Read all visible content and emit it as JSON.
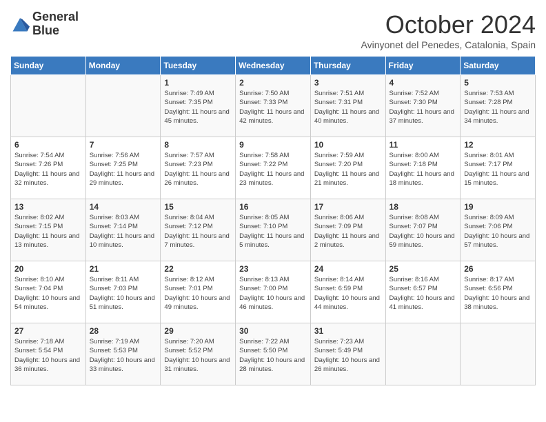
{
  "logo": {
    "line1": "General",
    "line2": "Blue"
  },
  "title": "October 2024",
  "subtitle": "Avinyonet del Penedes, Catalonia, Spain",
  "headers": [
    "Sunday",
    "Monday",
    "Tuesday",
    "Wednesday",
    "Thursday",
    "Friday",
    "Saturday"
  ],
  "weeks": [
    [
      {
        "day": "",
        "lines": []
      },
      {
        "day": "",
        "lines": []
      },
      {
        "day": "1",
        "lines": [
          "Sunrise: 7:49 AM",
          "Sunset: 7:35 PM",
          "Daylight: 11 hours and 45 minutes."
        ]
      },
      {
        "day": "2",
        "lines": [
          "Sunrise: 7:50 AM",
          "Sunset: 7:33 PM",
          "Daylight: 11 hours and 42 minutes."
        ]
      },
      {
        "day": "3",
        "lines": [
          "Sunrise: 7:51 AM",
          "Sunset: 7:31 PM",
          "Daylight: 11 hours and 40 minutes."
        ]
      },
      {
        "day": "4",
        "lines": [
          "Sunrise: 7:52 AM",
          "Sunset: 7:30 PM",
          "Daylight: 11 hours and 37 minutes."
        ]
      },
      {
        "day": "5",
        "lines": [
          "Sunrise: 7:53 AM",
          "Sunset: 7:28 PM",
          "Daylight: 11 hours and 34 minutes."
        ]
      }
    ],
    [
      {
        "day": "6",
        "lines": [
          "Sunrise: 7:54 AM",
          "Sunset: 7:26 PM",
          "Daylight: 11 hours and 32 minutes."
        ]
      },
      {
        "day": "7",
        "lines": [
          "Sunrise: 7:56 AM",
          "Sunset: 7:25 PM",
          "Daylight: 11 hours and 29 minutes."
        ]
      },
      {
        "day": "8",
        "lines": [
          "Sunrise: 7:57 AM",
          "Sunset: 7:23 PM",
          "Daylight: 11 hours and 26 minutes."
        ]
      },
      {
        "day": "9",
        "lines": [
          "Sunrise: 7:58 AM",
          "Sunset: 7:22 PM",
          "Daylight: 11 hours and 23 minutes."
        ]
      },
      {
        "day": "10",
        "lines": [
          "Sunrise: 7:59 AM",
          "Sunset: 7:20 PM",
          "Daylight: 11 hours and 21 minutes."
        ]
      },
      {
        "day": "11",
        "lines": [
          "Sunrise: 8:00 AM",
          "Sunset: 7:18 PM",
          "Daylight: 11 hours and 18 minutes."
        ]
      },
      {
        "day": "12",
        "lines": [
          "Sunrise: 8:01 AM",
          "Sunset: 7:17 PM",
          "Daylight: 11 hours and 15 minutes."
        ]
      }
    ],
    [
      {
        "day": "13",
        "lines": [
          "Sunrise: 8:02 AM",
          "Sunset: 7:15 PM",
          "Daylight: 11 hours and 13 minutes."
        ]
      },
      {
        "day": "14",
        "lines": [
          "Sunrise: 8:03 AM",
          "Sunset: 7:14 PM",
          "Daylight: 11 hours and 10 minutes."
        ]
      },
      {
        "day": "15",
        "lines": [
          "Sunrise: 8:04 AM",
          "Sunset: 7:12 PM",
          "Daylight: 11 hours and 7 minutes."
        ]
      },
      {
        "day": "16",
        "lines": [
          "Sunrise: 8:05 AM",
          "Sunset: 7:10 PM",
          "Daylight: 11 hours and 5 minutes."
        ]
      },
      {
        "day": "17",
        "lines": [
          "Sunrise: 8:06 AM",
          "Sunset: 7:09 PM",
          "Daylight: 11 hours and 2 minutes."
        ]
      },
      {
        "day": "18",
        "lines": [
          "Sunrise: 8:08 AM",
          "Sunset: 7:07 PM",
          "Daylight: 10 hours and 59 minutes."
        ]
      },
      {
        "day": "19",
        "lines": [
          "Sunrise: 8:09 AM",
          "Sunset: 7:06 PM",
          "Daylight: 10 hours and 57 minutes."
        ]
      }
    ],
    [
      {
        "day": "20",
        "lines": [
          "Sunrise: 8:10 AM",
          "Sunset: 7:04 PM",
          "Daylight: 10 hours and 54 minutes."
        ]
      },
      {
        "day": "21",
        "lines": [
          "Sunrise: 8:11 AM",
          "Sunset: 7:03 PM",
          "Daylight: 10 hours and 51 minutes."
        ]
      },
      {
        "day": "22",
        "lines": [
          "Sunrise: 8:12 AM",
          "Sunset: 7:01 PM",
          "Daylight: 10 hours and 49 minutes."
        ]
      },
      {
        "day": "23",
        "lines": [
          "Sunrise: 8:13 AM",
          "Sunset: 7:00 PM",
          "Daylight: 10 hours and 46 minutes."
        ]
      },
      {
        "day": "24",
        "lines": [
          "Sunrise: 8:14 AM",
          "Sunset: 6:59 PM",
          "Daylight: 10 hours and 44 minutes."
        ]
      },
      {
        "day": "25",
        "lines": [
          "Sunrise: 8:16 AM",
          "Sunset: 6:57 PM",
          "Daylight: 10 hours and 41 minutes."
        ]
      },
      {
        "day": "26",
        "lines": [
          "Sunrise: 8:17 AM",
          "Sunset: 6:56 PM",
          "Daylight: 10 hours and 38 minutes."
        ]
      }
    ],
    [
      {
        "day": "27",
        "lines": [
          "Sunrise: 7:18 AM",
          "Sunset: 5:54 PM",
          "Daylight: 10 hours and 36 minutes."
        ]
      },
      {
        "day": "28",
        "lines": [
          "Sunrise: 7:19 AM",
          "Sunset: 5:53 PM",
          "Daylight: 10 hours and 33 minutes."
        ]
      },
      {
        "day": "29",
        "lines": [
          "Sunrise: 7:20 AM",
          "Sunset: 5:52 PM",
          "Daylight: 10 hours and 31 minutes."
        ]
      },
      {
        "day": "30",
        "lines": [
          "Sunrise: 7:22 AM",
          "Sunset: 5:50 PM",
          "Daylight: 10 hours and 28 minutes."
        ]
      },
      {
        "day": "31",
        "lines": [
          "Sunrise: 7:23 AM",
          "Sunset: 5:49 PM",
          "Daylight: 10 hours and 26 minutes."
        ]
      },
      {
        "day": "",
        "lines": []
      },
      {
        "day": "",
        "lines": []
      }
    ]
  ]
}
